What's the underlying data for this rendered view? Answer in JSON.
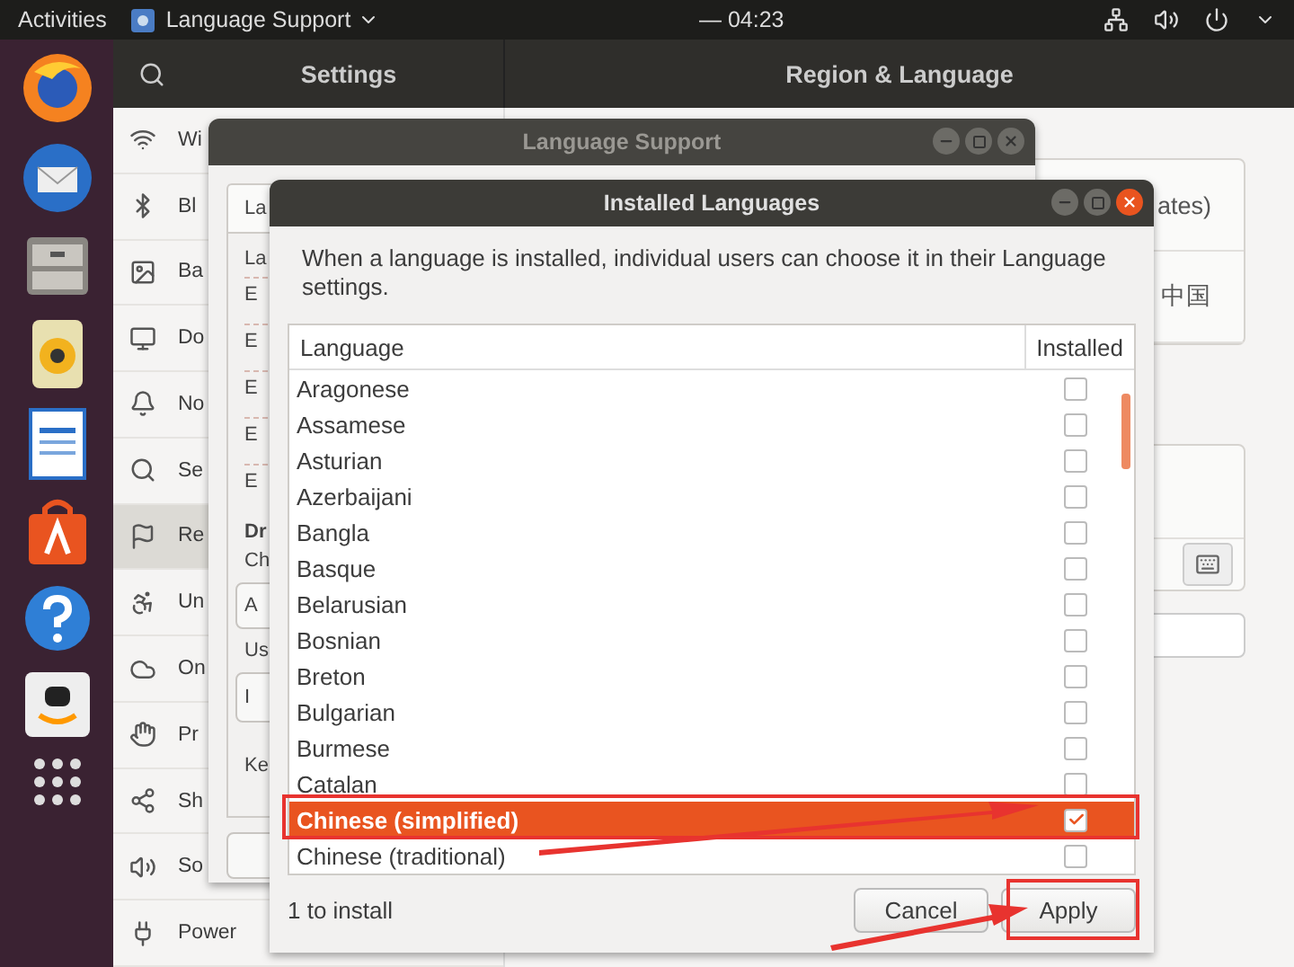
{
  "top_bar": {
    "activities": "Activities",
    "app_menu": "Language Support",
    "clock": "— 04:23"
  },
  "dock": [
    {
      "kind": "browser"
    },
    {
      "kind": "mail"
    },
    {
      "kind": "files"
    },
    {
      "kind": "speaker"
    },
    {
      "kind": "document"
    },
    {
      "kind": "bag"
    },
    {
      "kind": "help"
    },
    {
      "kind": "smile"
    },
    {
      "kind": "grid"
    }
  ],
  "settings": {
    "title": "Settings",
    "page_title": "Region & Language",
    "sidebar": [
      {
        "label": "Wi",
        "kind": "wifi",
        "selected": false
      },
      {
        "label": "Bl",
        "kind": "bluetooth",
        "selected": false
      },
      {
        "label": "Ba",
        "kind": "background",
        "selected": false
      },
      {
        "label": "Do",
        "kind": "dock",
        "selected": false
      },
      {
        "label": "No",
        "kind": "bell",
        "selected": false
      },
      {
        "label": "Se",
        "kind": "search",
        "selected": false
      },
      {
        "label": "Re",
        "kind": "region",
        "selected": true
      },
      {
        "label": "Un",
        "kind": "access",
        "selected": false
      },
      {
        "label": "On",
        "kind": "cloud",
        "selected": false
      },
      {
        "label": "Pr",
        "kind": "hand",
        "selected": false
      },
      {
        "label": "Sh",
        "kind": "share",
        "selected": false
      },
      {
        "label": "So",
        "kind": "sound",
        "selected": false
      },
      {
        "label": "Power",
        "kind": "power",
        "selected": false
      }
    ],
    "content": [
      "ates)",
      "中国"
    ]
  },
  "language_support": {
    "title": "Language Support",
    "tab": "La",
    "heading": "La",
    "list": [
      "E",
      "E",
      "E",
      "E",
      "E"
    ],
    "section_title": "Dr",
    "section_text": "Ch",
    "dropdown": "A",
    "label": "Us",
    "field": "I",
    "label_2": "Ke"
  },
  "installed_languages": {
    "title": "Installed Languages",
    "description": "When a language is installed, individual users can choose it in their Language settings.",
    "columns": [
      "Language",
      "Installed"
    ],
    "rows": [
      {
        "name": "Aragonese",
        "installed": false,
        "selected": false
      },
      {
        "name": "Assamese",
        "installed": false,
        "selected": false
      },
      {
        "name": "Asturian",
        "installed": false,
        "selected": false
      },
      {
        "name": "Azerbaijani",
        "installed": false,
        "selected": false
      },
      {
        "name": "Bangla",
        "installed": false,
        "selected": false
      },
      {
        "name": "Basque",
        "installed": false,
        "selected": false
      },
      {
        "name": "Belarusian",
        "installed": false,
        "selected": false
      },
      {
        "name": "Bosnian",
        "installed": false,
        "selected": false
      },
      {
        "name": "Breton",
        "installed": false,
        "selected": false
      },
      {
        "name": "Bulgarian",
        "installed": false,
        "selected": false
      },
      {
        "name": "Burmese",
        "installed": false,
        "selected": false
      },
      {
        "name": "Catalan",
        "installed": false,
        "selected": false
      },
      {
        "name": "Chinese (simplified)",
        "installed": true,
        "selected": true
      },
      {
        "name": "Chinese (traditional)",
        "installed": false,
        "selected": false
      }
    ],
    "status": "1 to install",
    "buttons": [
      "Cancel",
      "Apply"
    ]
  }
}
